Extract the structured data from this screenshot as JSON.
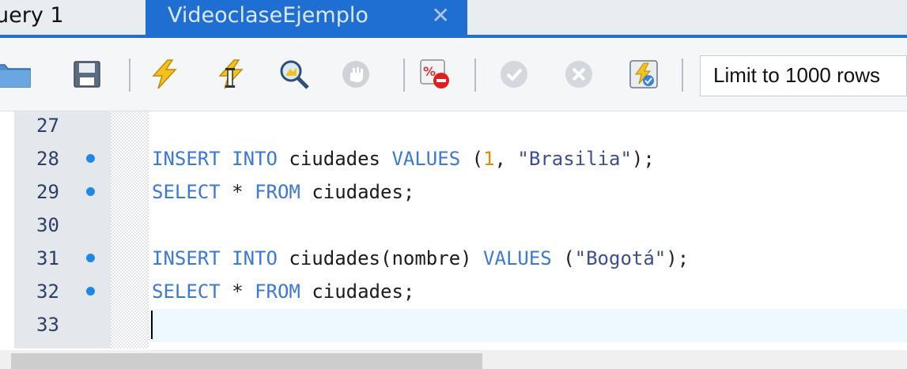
{
  "tabs": {
    "inactive_label": "uery 1",
    "active_label": "VideoclaseEjemplo",
    "close_glyph": "✕"
  },
  "toolbar": {
    "icons": [
      "open-folder-icon",
      "save-icon",
      "execute-icon",
      "execute-current-icon",
      "explain-icon",
      "stop-icon",
      "toggle-error-stop-icon",
      "commit-icon",
      "rollback-icon",
      "autocommit-icon"
    ],
    "limit_label": "Limit to 1000 rows"
  },
  "editor": {
    "lines": [
      {
        "num": "27",
        "dot": false,
        "tokens": []
      },
      {
        "num": "28",
        "dot": true,
        "tokens": [
          {
            "t": "INSERT",
            "c": "kw"
          },
          {
            "t": " ",
            "c": "pun"
          },
          {
            "t": "INTO",
            "c": "kw"
          },
          {
            "t": " ",
            "c": "pun"
          },
          {
            "t": "ciudades",
            "c": "idt"
          },
          {
            "t": " ",
            "c": "pun"
          },
          {
            "t": "VALUES",
            "c": "kw"
          },
          {
            "t": " (",
            "c": "pun"
          },
          {
            "t": "1",
            "c": "num"
          },
          {
            "t": ", ",
            "c": "pun"
          },
          {
            "t": "\"Brasilia\"",
            "c": "str"
          },
          {
            "t": ");",
            "c": "pun"
          }
        ]
      },
      {
        "num": "29",
        "dot": true,
        "tokens": [
          {
            "t": "SELECT",
            "c": "kw"
          },
          {
            "t": " * ",
            "c": "pun"
          },
          {
            "t": "FROM",
            "c": "kw"
          },
          {
            "t": " ",
            "c": "pun"
          },
          {
            "t": "ciudades",
            "c": "idt"
          },
          {
            "t": ";",
            "c": "pun"
          }
        ]
      },
      {
        "num": "30",
        "dot": false,
        "tokens": []
      },
      {
        "num": "31",
        "dot": true,
        "tokens": [
          {
            "t": "INSERT",
            "c": "kw"
          },
          {
            "t": " ",
            "c": "pun"
          },
          {
            "t": "INTO",
            "c": "kw"
          },
          {
            "t": " ",
            "c": "pun"
          },
          {
            "t": "ciudades(nombre)",
            "c": "idt"
          },
          {
            "t": " ",
            "c": "pun"
          },
          {
            "t": "VALUES",
            "c": "kw"
          },
          {
            "t": " (",
            "c": "pun"
          },
          {
            "t": "\"Bogotá\"",
            "c": "str"
          },
          {
            "t": ");",
            "c": "pun"
          }
        ]
      },
      {
        "num": "32",
        "dot": true,
        "tokens": [
          {
            "t": "SELECT",
            "c": "kw"
          },
          {
            "t": " * ",
            "c": "pun"
          },
          {
            "t": "FROM",
            "c": "kw"
          },
          {
            "t": " ",
            "c": "pun"
          },
          {
            "t": "ciudades",
            "c": "idt"
          },
          {
            "t": ";",
            "c": "pun"
          }
        ]
      },
      {
        "num": "33",
        "dot": false,
        "tokens": []
      }
    ]
  },
  "colors": {
    "accent": "#1f6fd2",
    "keyword": "#3b78d8",
    "number": "#e08a00",
    "statement_dot": "#1e88e5"
  }
}
